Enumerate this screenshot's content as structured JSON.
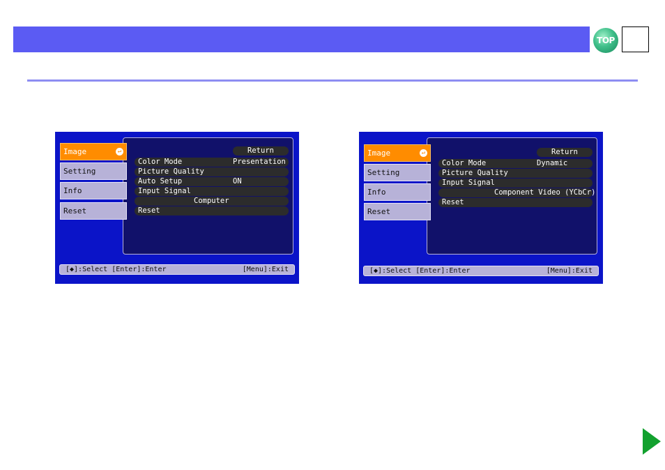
{
  "header": {
    "top_label": "TOP"
  },
  "screens": [
    {
      "tabs": [
        "Image",
        "Setting",
        "Info",
        "Reset"
      ],
      "return_label": "Return",
      "rows": [
        {
          "label": "Color Mode",
          "value": "Presentation"
        },
        {
          "label": "Picture Quality",
          "value": ""
        },
        {
          "label": "Auto Setup",
          "value": "ON"
        },
        {
          "label": "Input Signal",
          "value": ""
        },
        {
          "label": "",
          "value": "Computer"
        },
        {
          "label": "Reset",
          "value": ""
        }
      ],
      "status_left": "[◆]:Select [Enter]:Enter",
      "status_right": "[Menu]:Exit"
    },
    {
      "tabs": [
        "Image",
        "Setting",
        "Info",
        "Reset"
      ],
      "return_label": "Return",
      "rows": [
        {
          "label": "Color Mode",
          "value": "Dynamic"
        },
        {
          "label": "Picture Quality",
          "value": ""
        },
        {
          "label": "Input Signal",
          "value": ""
        },
        {
          "label": "",
          "value": "Component Video (YCbCr)"
        },
        {
          "label": "Reset",
          "value": ""
        }
      ],
      "status_left": "[◆]:Select [Enter]:Enter",
      "status_right": "[Menu]:Exit"
    }
  ],
  "colors": {
    "header": "#5b5bf3",
    "screen_bg": "#0b14c8",
    "active_tab": "#ff8c00",
    "next_arrow": "#12a12e"
  },
  "icons": {
    "enter": "enter-return-icon",
    "next": "next-page-arrow-icon",
    "select": "up-down-arrow-icon"
  }
}
